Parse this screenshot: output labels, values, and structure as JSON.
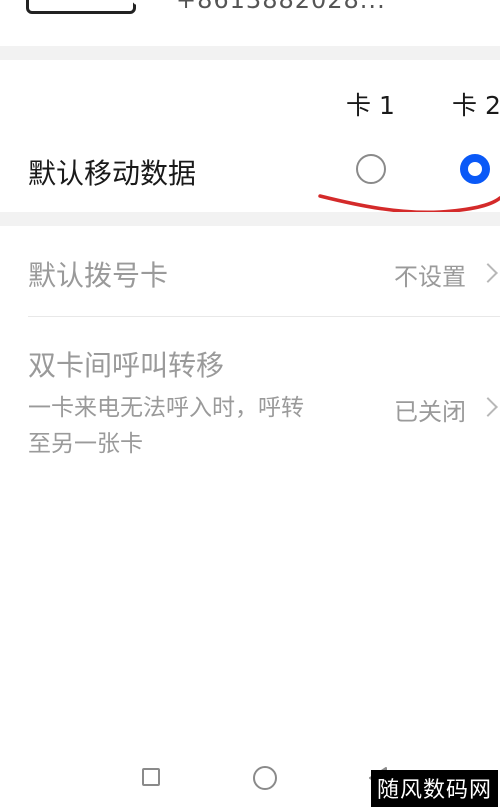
{
  "top": {
    "number_partial": "+8613882028..."
  },
  "default_data": {
    "sim1_header": "卡 1",
    "sim2_header": "卡 2",
    "label": "默认移动数据",
    "sim1_selected": false,
    "sim2_selected": true
  },
  "rows": [
    {
      "title": "默认拨号卡",
      "value": "不设置"
    },
    {
      "title": "双卡间呼叫转移",
      "subtitle_line1": "一卡来电无法呼入时，呼转",
      "subtitle_line2": "至另一张卡",
      "value": "已关闭"
    }
  ],
  "colors": {
    "accent_blue": "#0a59f7",
    "annotation_red": "#d42a2a",
    "muted_text": "#9a9a9a"
  },
  "watermark": "随风数码网"
}
